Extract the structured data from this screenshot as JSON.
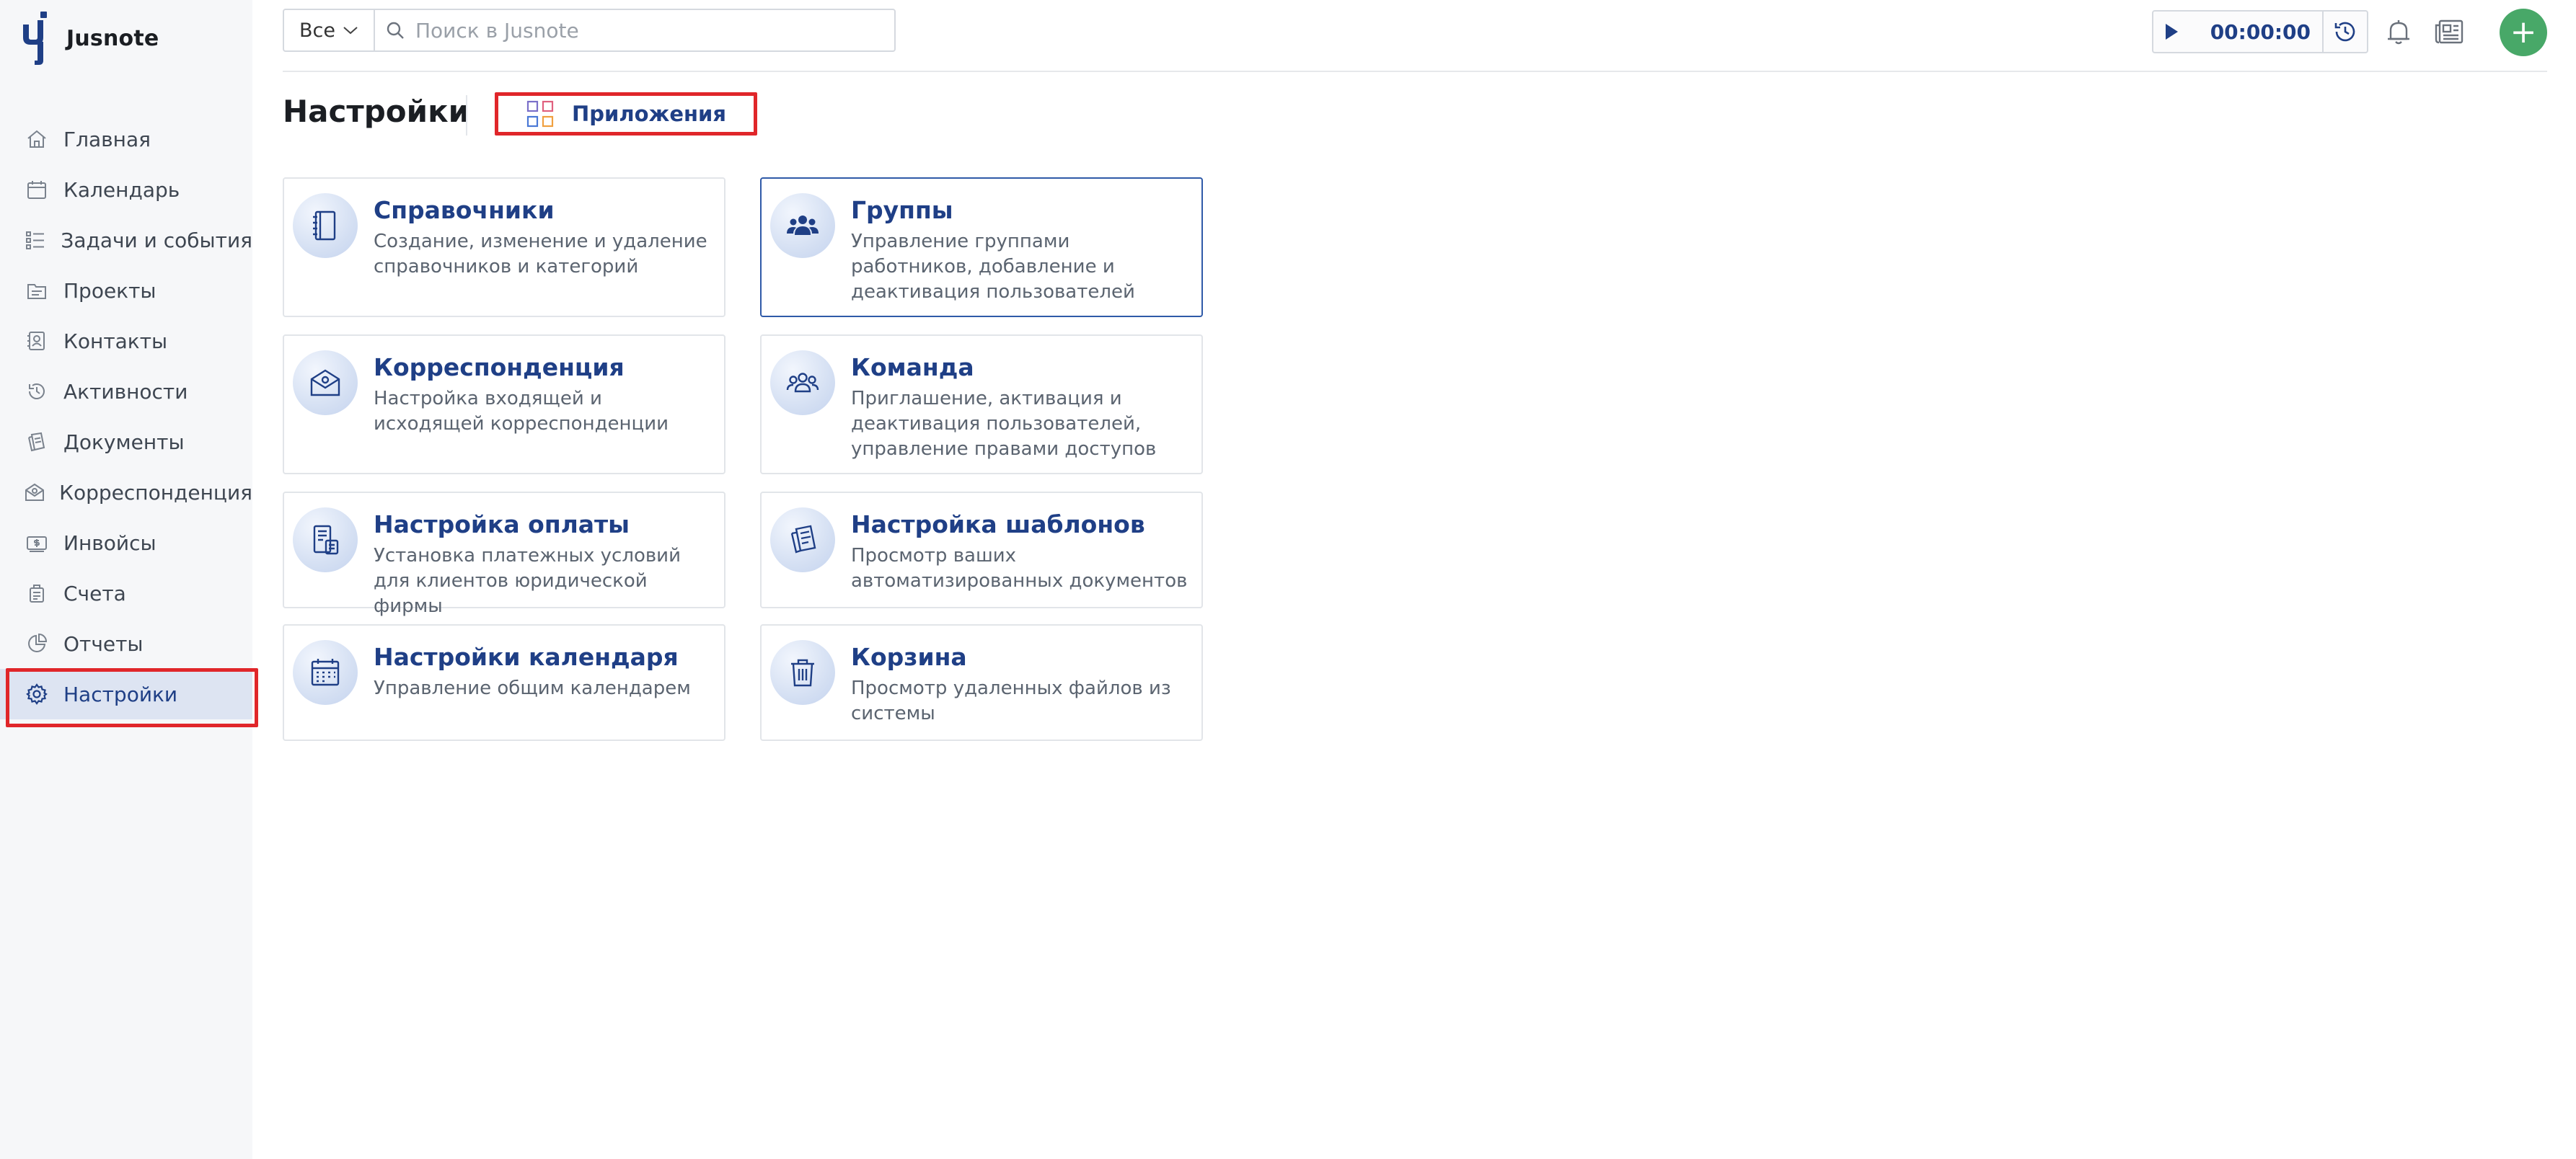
{
  "app": {
    "name": "Jusnote"
  },
  "sidebar": {
    "items": [
      {
        "label": "Главная",
        "icon": "home-icon"
      },
      {
        "label": "Календарь",
        "icon": "calendar-icon"
      },
      {
        "label": "Задачи и события",
        "icon": "tasks-icon"
      },
      {
        "label": "Проекты",
        "icon": "projects-icon"
      },
      {
        "label": "Контакты",
        "icon": "contacts-icon"
      },
      {
        "label": "Активности",
        "icon": "activity-icon"
      },
      {
        "label": "Документы",
        "icon": "documents-icon"
      },
      {
        "label": "Корреспонденция",
        "icon": "correspondence-icon"
      },
      {
        "label": "Инвойсы",
        "icon": "invoice-icon"
      },
      {
        "label": "Счета",
        "icon": "bills-icon"
      },
      {
        "label": "Отчеты",
        "icon": "reports-icon"
      },
      {
        "label": "Настройки",
        "icon": "settings-icon",
        "active": true
      }
    ]
  },
  "topbar": {
    "scope_value": "Все",
    "search_placeholder": "Поиск в Jusnote",
    "search_value": "",
    "timer_value": "00:00:00",
    "add_label": "+"
  },
  "page": {
    "title": "Настройки",
    "apps_tab_label": "Приложения"
  },
  "cards": [
    {
      "title": "Справочники",
      "description": "Создание, изменение и удаление справочников и категорий",
      "icon": "notebook-icon"
    },
    {
      "title": "Группы",
      "description": "Управление группами работников, добавление и деактивация пользователей",
      "icon": "group-icon",
      "selected": true
    },
    {
      "title": "Корреспонденция",
      "description": "Настройка входящей и исходящей корреспонденции",
      "icon": "mail-icon"
    },
    {
      "title": "Команда",
      "description": "Приглашение, активация и деактивация пользователей, управление правами доступов",
      "icon": "team-icon"
    },
    {
      "title": "Настройка оплаты",
      "description": "Установка платежных условий для клиентов юридической фирмы",
      "icon": "payment-icon"
    },
    {
      "title": "Настройка шаблонов",
      "description": "Просмотр ваших автоматизированных документов",
      "icon": "templates-icon"
    },
    {
      "title": "Настройки календаря",
      "description": "Управление общим календарем",
      "icon": "calendar-settings-icon"
    },
    {
      "title": "Корзина",
      "description": "Просмотр удаленных файлов из системы",
      "icon": "trash-icon"
    }
  ],
  "colors": {
    "accent": "#1f3f86",
    "active_bg": "#dde4f2",
    "highlight_red": "#e0262a",
    "add_button": "#48a868"
  }
}
